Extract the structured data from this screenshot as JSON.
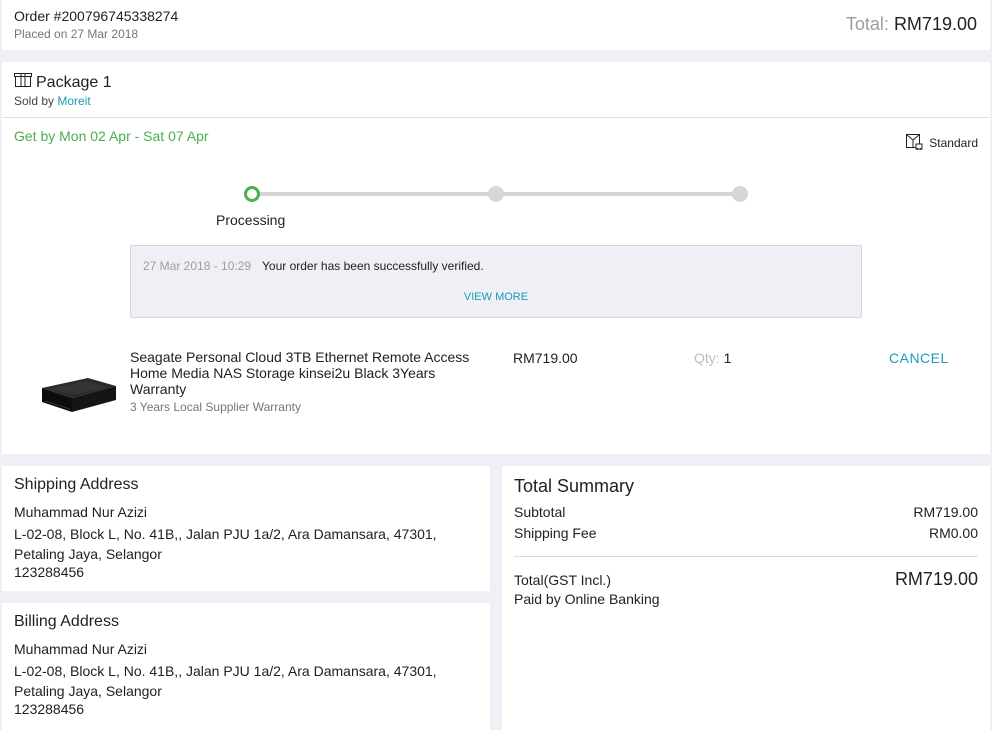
{
  "order": {
    "number": "Order #200796745338274",
    "placed": "Placed on 27 Mar 2018",
    "total_label": "Total: ",
    "total_amount": "RM719.00"
  },
  "package": {
    "title": "Package 1",
    "sold_by_label": "Sold by ",
    "seller": "Moreit",
    "delivery_estimate": "Get by Mon 02 Apr - Sat 07 Apr",
    "shipping_method": "Standard",
    "progress": {
      "steps_total": 3,
      "current_step": 1,
      "current_label": "Processing"
    },
    "status": {
      "timestamp": "27 Mar 2018 - 10:29",
      "message": "Your order has been successfully verified.",
      "view_more": "VIEW MORE"
    },
    "item": {
      "name": "Seagate Personal Cloud 3TB Ethernet Remote Access Home Media NAS Storage kinsei2u Black 3Years Warranty",
      "variant": "3 Years Local Supplier Warranty",
      "price": "RM719.00",
      "qty_label": "Qty: ",
      "qty": "1",
      "cancel": "CANCEL"
    }
  },
  "shipping_address": {
    "title": "Shipping Address",
    "name": "Muhammad Nur Azizi",
    "address": "L-02-08, Block L, No. 41B,, Jalan PJU 1a/2, Ara Damansara, 47301, Petaling Jaya, Selangor",
    "phone": "123288456"
  },
  "billing_address": {
    "title": "Billing Address",
    "name": "Muhammad Nur Azizi",
    "address": "L-02-08, Block L, No. 41B,, Jalan PJU 1a/2, Ara Damansara, 47301, Petaling Jaya, Selangor",
    "phone": "123288456"
  },
  "summary": {
    "title": "Total Summary",
    "subtotal_label": "Subtotal",
    "subtotal": "RM719.00",
    "shipping_label": "Shipping Fee",
    "shipping": "RM0.00",
    "total_label": "Total(GST Incl.)",
    "total": "RM719.00",
    "payment": "Paid by Online Banking"
  },
  "colors": {
    "accent": "#1a9cb7",
    "success": "#4caf50",
    "background": "#eff0f5"
  },
  "icons": {
    "package": "package-icon",
    "shipping": "delivery-box-icon"
  }
}
